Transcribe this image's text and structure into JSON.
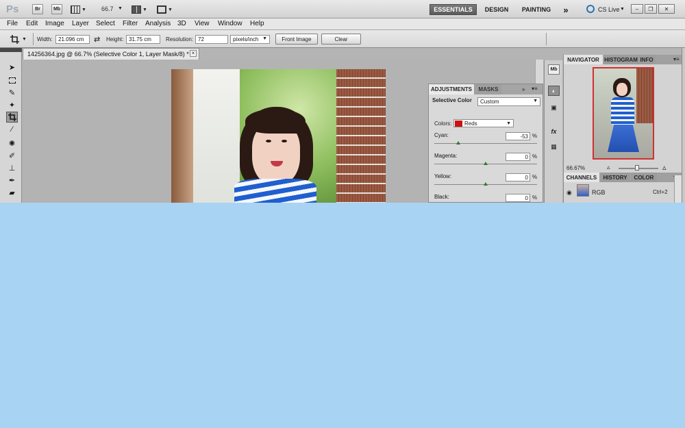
{
  "appbar": {
    "logo": "Ps",
    "br_label": "Br",
    "mb_label": "Mb",
    "zoom": "66.7",
    "workspaces": [
      "ESSENTIALS",
      "DESIGN",
      "PAINTING"
    ],
    "more_workspaces": "»",
    "cs_live": "CS Live"
  },
  "menu": [
    "File",
    "Edit",
    "Image",
    "Layer",
    "Select",
    "Filter",
    "Analysis",
    "3D",
    "View",
    "Window",
    "Help"
  ],
  "options": {
    "width_label": "Width:",
    "width_value": "21.096 cm",
    "height_label": "Height:",
    "height_value": "31.75 cm",
    "resolution_label": "Resolution:",
    "resolution_value": "72",
    "resolution_unit": "pixels/inch",
    "front_image": "Front Image",
    "clear": "Clear"
  },
  "document": {
    "tab_title": "14256364.jpg @ 66.7% (Selective Color 1, Layer Mask/8) *",
    "close": "×"
  },
  "adjustments": {
    "tabs": [
      "ADJUSTMENTS",
      "MASKS"
    ],
    "title": "Selective Color",
    "preset": "Custom",
    "colors_label": "Colors:",
    "colors_value": "Reds",
    "colors_swatch": "#cc1111",
    "sliders": [
      {
        "label": "Cyan:",
        "value": "-53",
        "unit": "%",
        "level": 0.235
      },
      {
        "label": "Magenta:",
        "value": "0",
        "unit": "%",
        "level": 0.5
      },
      {
        "label": "Yellow:",
        "value": "0",
        "unit": "%",
        "level": 0.5
      },
      {
        "label": "Black:",
        "value": "0",
        "unit": "%",
        "level": 0.5
      }
    ]
  },
  "navigator": {
    "tabs": [
      "NAVIGATOR",
      "HISTOGRAM",
      "INFO"
    ],
    "zoom": "66.67%"
  },
  "channels": {
    "tabs": [
      "CHANNELS",
      "HISTORY",
      "COLOR"
    ],
    "row_name": "RGB",
    "row_shortcut": "Ctrl+2"
  },
  "colors": {
    "desktop": "#a9d3f2",
    "accent": "#cc1111"
  }
}
